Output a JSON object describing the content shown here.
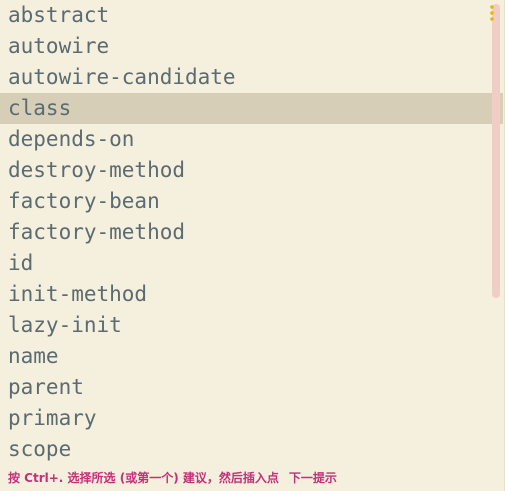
{
  "completion": {
    "items": [
      {
        "label": "abstract"
      },
      {
        "label": "autowire"
      },
      {
        "label": "autowire-candidate"
      },
      {
        "label": "class"
      },
      {
        "label": "depends-on"
      },
      {
        "label": "destroy-method"
      },
      {
        "label": "factory-bean"
      },
      {
        "label": "factory-method"
      },
      {
        "label": "id"
      },
      {
        "label": "init-method"
      },
      {
        "label": "lazy-init"
      },
      {
        "label": "name"
      },
      {
        "label": "parent"
      },
      {
        "label": "primary"
      },
      {
        "label": "scope"
      }
    ],
    "selected_index": 3
  },
  "footer": {
    "hint": "按 Ctrl+. 选择所选 (或第一个) 建议，然后插入点",
    "next_tip": "下一提示"
  },
  "colors": {
    "background": "#f5efdd",
    "selected_row": "#d6ceb6",
    "item_text": "#5b6b72",
    "hint_text": "#c2317a",
    "scrollbar_thumb": "#f2cdc6",
    "more_icon": "#e6b800"
  },
  "icons": {
    "more": "vertical-ellipsis-icon"
  }
}
